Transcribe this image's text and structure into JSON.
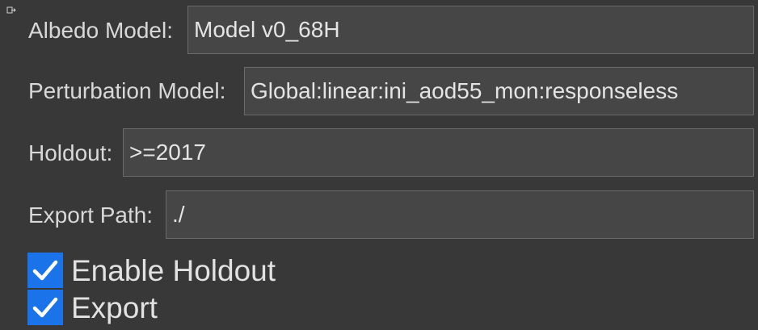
{
  "form": {
    "albedo": {
      "label": "Albedo Model:",
      "value": "Model v0_68H"
    },
    "perturbation": {
      "label": "Perturbation Model:",
      "value": "Global:linear:ini_aod55_mon:responseless"
    },
    "holdout": {
      "label": "Holdout:",
      "value": ">=2017"
    },
    "export_path": {
      "label": "Export Path:",
      "value": "./"
    }
  },
  "checkboxes": [
    {
      "label": "Enable Holdout",
      "checked": true
    },
    {
      "label": "Export",
      "checked": true
    }
  ],
  "icons": {
    "corner": "collapse-arrow-icon",
    "check": "checkmark-icon"
  },
  "colors": {
    "background": "#383838",
    "field": "#464646",
    "checkbox_accent": "#1a73e8"
  }
}
